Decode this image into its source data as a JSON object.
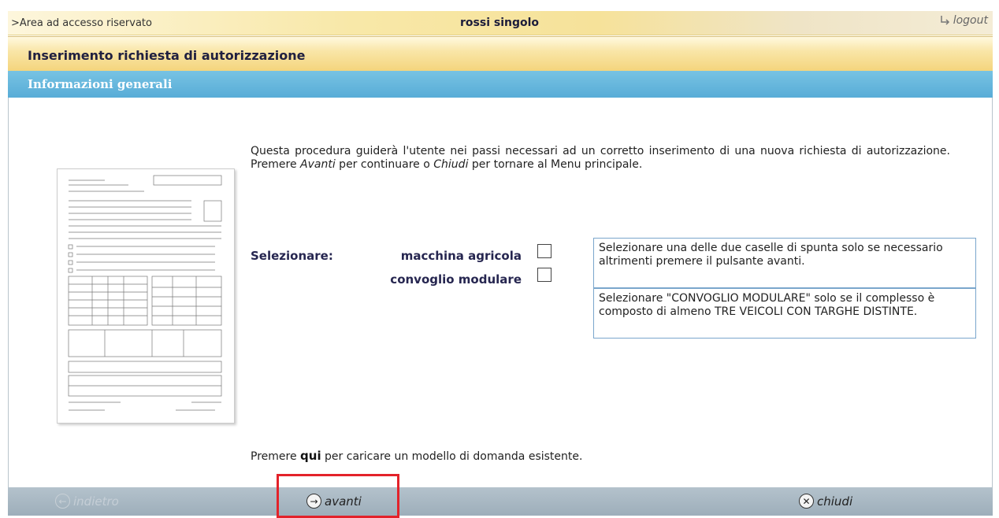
{
  "topbar": {
    "area": ">Area ad accesso riservato",
    "user": "rossi singolo",
    "logout": "logout"
  },
  "title": "Inserimento richiesta di autorizzazione",
  "section": "Informazioni generali",
  "intro": {
    "part1": "Questa procedura guiderà l'utente nei passi necessari ad un corretto inserimento di una nuova richiesta di autorizzazione. Premere ",
    "avanti": "Avanti",
    "part2": " per continuare o ",
    "chiudi": "Chiudi",
    "part3": " per tornare al Menu principale."
  },
  "selection": {
    "label": "Selezionare:",
    "option1": "macchina agricola",
    "option2": "convoglio modulare",
    "option1_checked": false,
    "option2_checked": false
  },
  "info1": "Selezionare una delle due caselle di spunta solo se necessario altrimenti premere il pulsante avanti.",
  "info2": "Selezionare \"CONVOGLIO MODULARE\" solo se il complesso è composto di almeno TRE VEICOLI CON TARGHE DISTINTE.",
  "load": {
    "before": "Premere ",
    "link": "qui",
    "after": " per caricare un modello di domanda esistente."
  },
  "footer": {
    "back": "indietro",
    "next": "avanti",
    "close": "chiudi"
  },
  "colors": {
    "highlight": "#e3222a",
    "header_blue": "#58acd7",
    "header_yellow": "#f4d47b"
  }
}
